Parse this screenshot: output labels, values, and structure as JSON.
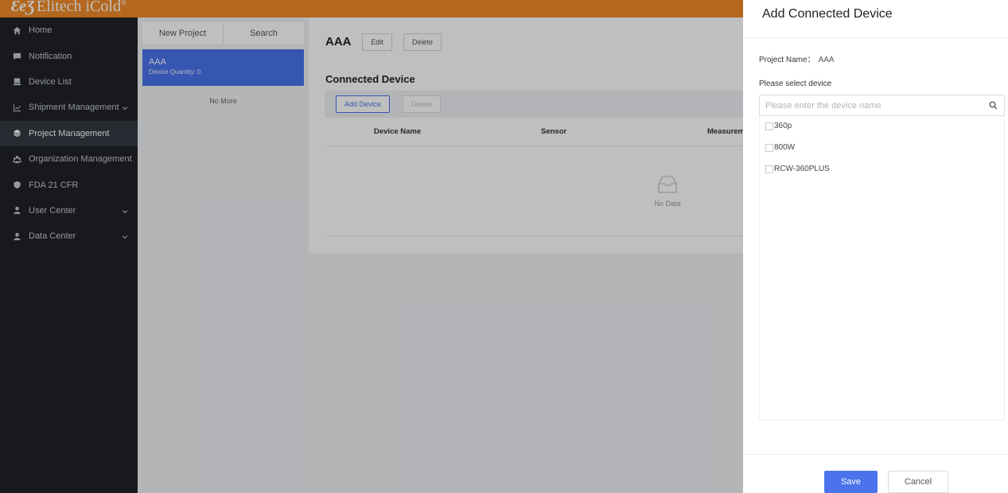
{
  "app": {
    "logo_mark": "ƐeƷ",
    "logo_text": "Elitech iCold",
    "logo_reg": "®",
    "brand_color": "#f08a28",
    "accent_color": "#4a73ec"
  },
  "sidebar": {
    "items": [
      {
        "label": "Home",
        "icon": "home-icon",
        "has_submenu": false,
        "active": false
      },
      {
        "label": "Notification",
        "icon": "message-icon",
        "has_submenu": false,
        "active": false
      },
      {
        "label": "Device List",
        "icon": "device-icon",
        "has_submenu": false,
        "active": false
      },
      {
        "label": "Shipment Management",
        "icon": "chart-icon",
        "has_submenu": true,
        "active": false
      },
      {
        "label": "Project Management",
        "icon": "layers-icon",
        "has_submenu": false,
        "active": true
      },
      {
        "label": "Organization Management",
        "icon": "org-icon",
        "has_submenu": false,
        "active": false
      },
      {
        "label": "FDA 21 CFR",
        "icon": "shield-icon",
        "has_submenu": false,
        "active": false
      },
      {
        "label": "User Center",
        "icon": "user-icon",
        "has_submenu": true,
        "active": false
      },
      {
        "label": "Data Center",
        "icon": "data-icon",
        "has_submenu": true,
        "active": false
      }
    ]
  },
  "projects": {
    "tab_new": "New Project",
    "tab_search": "Search",
    "selected": {
      "name": "AAA",
      "quantity": "Device Quantity: 0"
    },
    "no_more": "No More"
  },
  "main": {
    "title": "AAA",
    "edit_label": "Edit",
    "delete_label": "Delete",
    "section_title": "Connected Device",
    "add_device_label": "Add Device",
    "delete_device_label": "Delete",
    "columns": [
      "Device Name",
      "Sensor",
      "Measurem"
    ],
    "no_data": "No Data"
  },
  "drawer": {
    "title": "Add Connected Device",
    "project_name_label": "Project Name：",
    "project_name_value": "AAA",
    "select_label": "Please select device",
    "search_placeholder": "Please enter the device name",
    "devices": [
      "360p",
      "800W",
      "RCW-360PLUS"
    ],
    "save_label": "Save",
    "cancel_label": "Cancel"
  }
}
